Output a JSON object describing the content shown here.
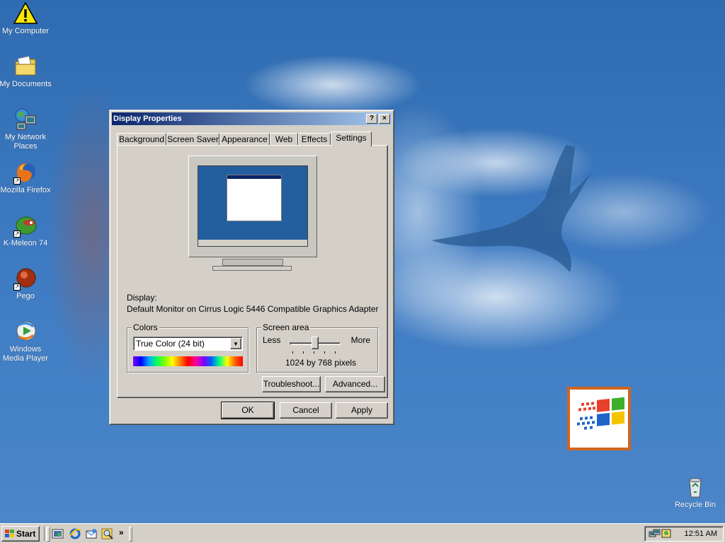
{
  "desktop": {
    "icons": [
      {
        "label": "My Computer",
        "icon": "warning-icon"
      },
      {
        "label": "My Documents",
        "icon": "folder-icon"
      },
      {
        "label": "My Network Places",
        "icon": "network-icon"
      },
      {
        "label": "Mozilla Firefox",
        "icon": "firefox-icon"
      },
      {
        "label": "K-Meleon 74",
        "icon": "k-meleon-icon"
      },
      {
        "label": "Pego",
        "icon": "pego-icon"
      },
      {
        "label": "Windows Media Player",
        "icon": "media-player-icon"
      },
      {
        "label": "Recycle Bin",
        "icon": "recycle-bin-icon"
      }
    ]
  },
  "dialog": {
    "title": "Display Properties",
    "help_button": "?",
    "close_button": "×",
    "tabs": [
      "Background",
      "Screen Saver",
      "Appearance",
      "Web",
      "Effects",
      "Settings"
    ],
    "active_tab": "Settings",
    "display_label": "Display:",
    "display_value": "Default Monitor on Cirrus Logic 5446 Compatible Graphics Adapter",
    "colors": {
      "title": "Colors",
      "selected": "True Color (24 bit)"
    },
    "screen_area": {
      "title": "Screen area",
      "less": "Less",
      "more": "More",
      "resolution": "1024 by 768 pixels",
      "slider_position": 0.5
    },
    "troubleshoot_button": "Troubleshoot...",
    "advanced_button": "Advanced...",
    "ok_button": "OK",
    "cancel_button": "Cancel",
    "apply_button": "Apply"
  },
  "taskbar": {
    "start_label": "Start",
    "chevron": "»",
    "clock": "12:51 AM"
  },
  "colors": {
    "desktop_blue": "#3a6ea5",
    "title_start": "#0a246a",
    "title_end": "#a6caf0",
    "face": "#d4d0c8",
    "logo_border": "#d0651f"
  }
}
